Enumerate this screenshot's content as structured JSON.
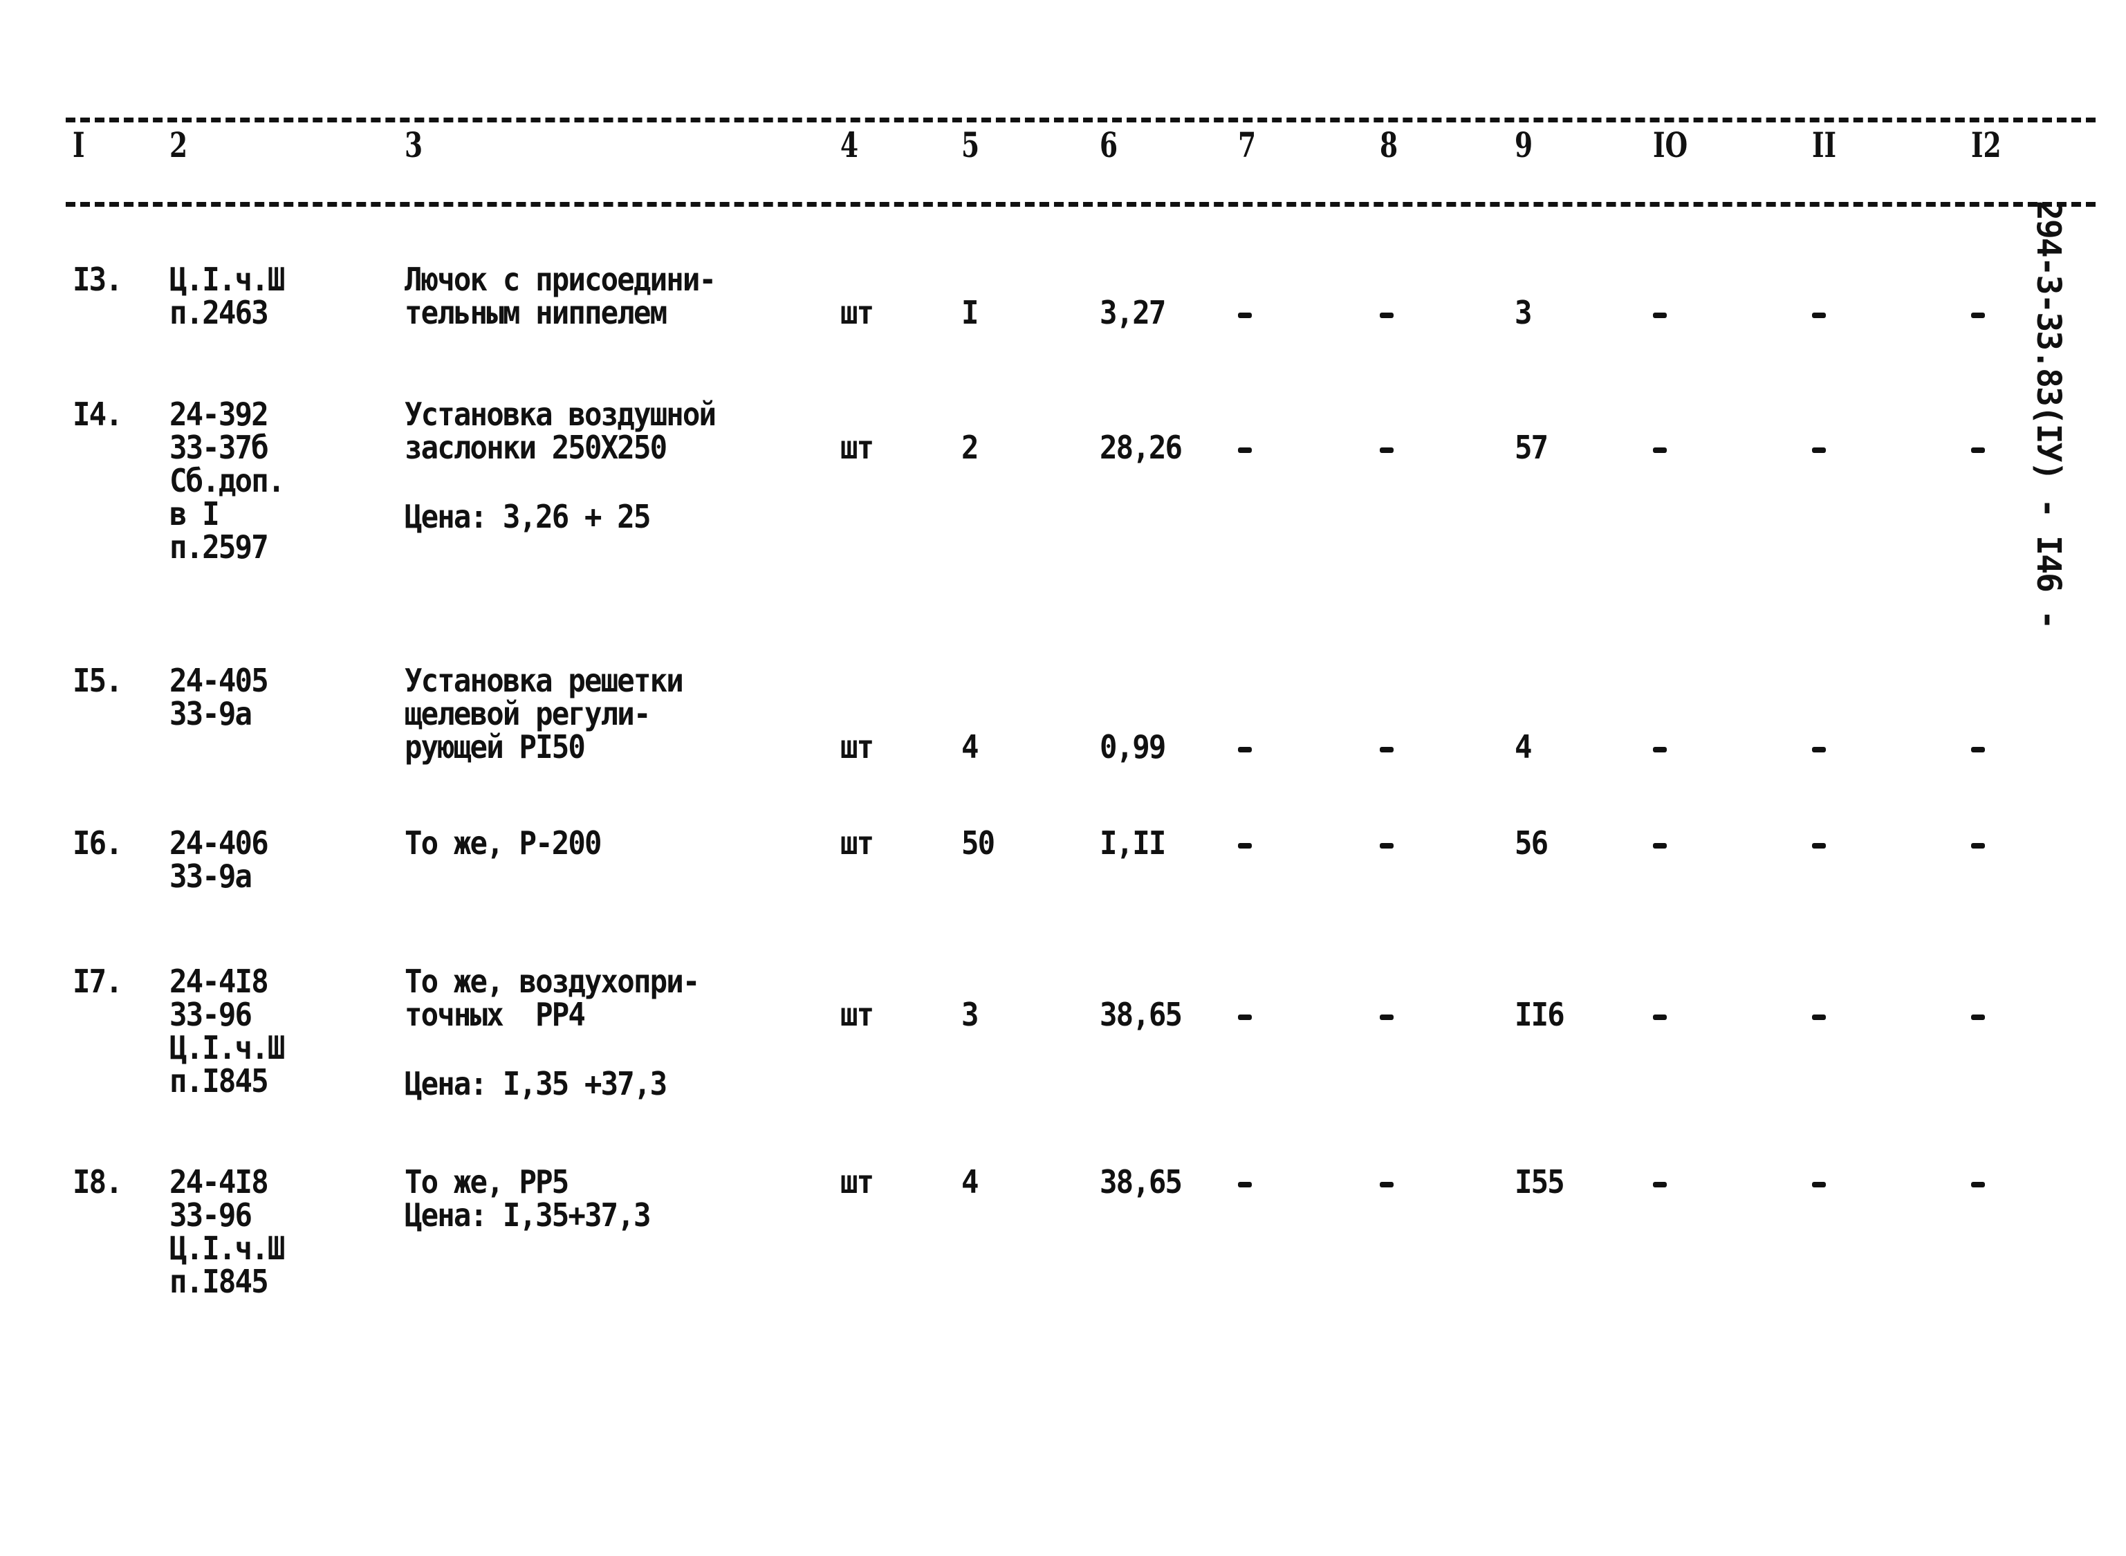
{
  "side_label": "294-3-33.83(IУ) - I46 -",
  "header_columns": [
    "I",
    "2",
    "3",
    "4",
    "5",
    "6",
    "7",
    "8",
    "9",
    "IO",
    "II",
    "I2"
  ],
  "rows": [
    {
      "num": "I3.",
      "ref": [
        "Ц.I.ч.Ш",
        "п.2463"
      ],
      "name": [
        "Лючок с присоедини-",
        "тельным ниппелем"
      ],
      "price_note": "",
      "unit": "шт",
      "qty": "I",
      "c6": "3,27",
      "c7": "-",
      "c8": "-",
      "c9": "3",
      "c10": "-",
      "c11": "-",
      "c12": "-"
    },
    {
      "num": "I4.",
      "ref": [
        "24-392",
        "33-37б",
        "Сб.доп.",
        "в I",
        "п.2597"
      ],
      "name": [
        "Установка воздушной",
        "заслонки 250Х250"
      ],
      "price_note": "Цена: 3,26 + 25",
      "unit": "шт",
      "qty": "2",
      "c6": "28,26",
      "c7": "-",
      "c8": "-",
      "c9": "57",
      "c10": "-",
      "c11": "-",
      "c12": "-"
    },
    {
      "num": "I5.",
      "ref": [
        "24-405",
        "33-9а"
      ],
      "name": [
        "Установка решетки",
        "щелевой регули-",
        "рующей PI50"
      ],
      "price_note": "",
      "unit": "шт",
      "qty": "4",
      "c6": "0,99",
      "c7": "-",
      "c8": "-",
      "c9": "4",
      "c10": "-",
      "c11": "-",
      "c12": "-"
    },
    {
      "num": "I6.",
      "ref": [
        "24-406",
        "33-9а"
      ],
      "name": [
        "То же, Р-200"
      ],
      "price_note": "",
      "unit": "шт",
      "qty": "50",
      "c6": "I,II",
      "c7": "-",
      "c8": "-",
      "c9": "56",
      "c10": "-",
      "c11": "-",
      "c12": "-"
    },
    {
      "num": "I7.",
      "ref": [
        "24-4I8",
        "33-96",
        "Ц.I.ч.Ш",
        "п.I845"
      ],
      "name": [
        "То же, воздухопри-",
        "точных  РР4"
      ],
      "price_note": "Цена: I,35 +37,3",
      "unit": "шт",
      "qty": "3",
      "c6": "38,65",
      "c7": "-",
      "c8": "-",
      "c9": "II6",
      "c10": "-",
      "c11": "-",
      "c12": "-"
    },
    {
      "num": "I8.",
      "ref": [
        "24-4I8",
        "33-96",
        "Ц.I.ч.Ш",
        "п.I845"
      ],
      "name": [
        "То же, РР5",
        "Цена: I,35+37,3"
      ],
      "price_note": "",
      "unit": "шт",
      "qty": "4",
      "c6": "38,65",
      "c7": "-",
      "c8": "-",
      "c9": "I55",
      "c10": "-",
      "c11": "-",
      "c12": "-"
    }
  ]
}
